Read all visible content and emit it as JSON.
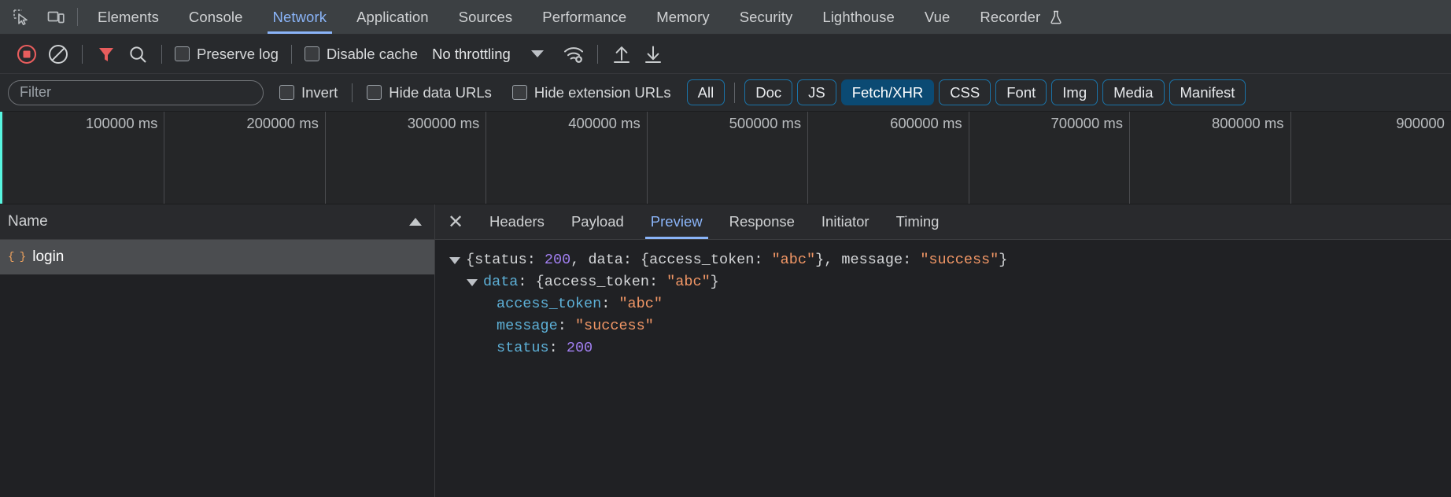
{
  "tabbar": {
    "icons": [
      {
        "name": "inspect-element-icon",
        "glyph": "inspect"
      },
      {
        "name": "device-toolbar-icon",
        "glyph": "device"
      }
    ],
    "tabs": [
      {
        "label": "Elements",
        "active": false
      },
      {
        "label": "Console",
        "active": false
      },
      {
        "label": "Network",
        "active": true
      },
      {
        "label": "Application",
        "active": false
      },
      {
        "label": "Sources",
        "active": false
      },
      {
        "label": "Performance",
        "active": false
      },
      {
        "label": "Memory",
        "active": false
      },
      {
        "label": "Security",
        "active": false
      },
      {
        "label": "Lighthouse",
        "active": false
      },
      {
        "label": "Vue",
        "active": false
      },
      {
        "label": "Recorder",
        "active": false
      }
    ],
    "recorder_flask_icon": "flask-icon",
    "active_tab_color": "#8ab4f8"
  },
  "toolbar": {
    "record_button": {
      "name": "record-stop-button",
      "state": "recording",
      "color": "#e85d5d"
    },
    "clear_button": {
      "name": "clear-button",
      "label": "Clear"
    },
    "filter_toggle": {
      "name": "filter-funnel-icon",
      "active": true,
      "color": "#e85d5d"
    },
    "search_button": {
      "name": "search-icon"
    },
    "preserve_log": {
      "label": "Preserve log",
      "checked": false
    },
    "disable_cache": {
      "label": "Disable cache",
      "checked": false
    },
    "throttling": {
      "value": "No throttling"
    },
    "network_conditions_icon": "wifi-gear-icon",
    "import_har_icon": "upload-arrow-icon",
    "export_har_icon": "download-arrow-icon"
  },
  "filterbar": {
    "filter_input": {
      "value": "",
      "placeholder": "Filter"
    },
    "invert": {
      "label": "Invert",
      "checked": false
    },
    "hide_data_urls": {
      "label": "Hide data URLs",
      "checked": false
    },
    "hide_extension_urls": {
      "label": "Hide extension URLs",
      "checked": false
    },
    "type_pills": [
      {
        "label": "All",
        "selected": false
      },
      {
        "label": "Doc",
        "selected": false
      },
      {
        "label": "JS",
        "selected": false
      },
      {
        "label": "Fetch/XHR",
        "selected": true
      },
      {
        "label": "CSS",
        "selected": false
      },
      {
        "label": "Font",
        "selected": false
      },
      {
        "label": "Img",
        "selected": false
      },
      {
        "label": "Media",
        "selected": false
      },
      {
        "label": "Manifest",
        "selected": false
      }
    ],
    "pill_outline_color": "#1a73a8",
    "pill_selected_bg": "#0b4a73"
  },
  "overview": {
    "ticks": [
      "100000 ms",
      "200000 ms",
      "300000 ms",
      "400000 ms",
      "500000 ms",
      "600000 ms",
      "700000 ms",
      "800000 ms",
      "900000"
    ],
    "left_marker_color": "#57f5e0"
  },
  "request_list": {
    "column_header": "Name",
    "sort_direction": "ascending",
    "rows": [
      {
        "name": "login",
        "icon": "json-file-icon",
        "selected": true
      }
    ]
  },
  "detail_pane": {
    "close_label": "✕",
    "tabs": [
      {
        "label": "Headers",
        "active": false
      },
      {
        "label": "Payload",
        "active": false
      },
      {
        "label": "Preview",
        "active": true
      },
      {
        "label": "Response",
        "active": false
      },
      {
        "label": "Initiator",
        "active": false
      },
      {
        "label": "Timing",
        "active": false
      }
    ],
    "preview": {
      "lines": [
        {
          "indent": 0,
          "twisty": "open",
          "segments": [
            {
              "text": "{status: ",
              "cls": "plain"
            },
            {
              "text": "200",
              "cls": "num"
            },
            {
              "text": ", data: {access_token: ",
              "cls": "plain"
            },
            {
              "text": "\"abc\"",
              "cls": "str"
            },
            {
              "text": "}, message: ",
              "cls": "plain"
            },
            {
              "text": "\"success\"",
              "cls": "str"
            },
            {
              "text": "}",
              "cls": "plain"
            }
          ]
        },
        {
          "indent": 1,
          "twisty": "open",
          "segments": [
            {
              "text": "data",
              "cls": "key"
            },
            {
              "text": ": {access_token: ",
              "cls": "plain"
            },
            {
              "text": "\"abc\"",
              "cls": "str"
            },
            {
              "text": "}",
              "cls": "plain"
            }
          ]
        },
        {
          "indent": 2,
          "twisty": "none",
          "segments": [
            {
              "text": "access_token",
              "cls": "key"
            },
            {
              "text": ": ",
              "cls": "plain"
            },
            {
              "text": "\"abc\"",
              "cls": "str"
            }
          ]
        },
        {
          "indent": 2,
          "twisty": "none",
          "segments": [
            {
              "text": "message",
              "cls": "key"
            },
            {
              "text": ": ",
              "cls": "plain"
            },
            {
              "text": "\"success\"",
              "cls": "str"
            }
          ]
        },
        {
          "indent": 2,
          "twisty": "none",
          "segments": [
            {
              "text": "status",
              "cls": "key"
            },
            {
              "text": ": ",
              "cls": "plain"
            },
            {
              "text": "200",
              "cls": "num"
            }
          ]
        }
      ],
      "colors": {
        "key": "#5db0d7",
        "string": "#f29766",
        "number": "#a17ff0"
      }
    }
  }
}
